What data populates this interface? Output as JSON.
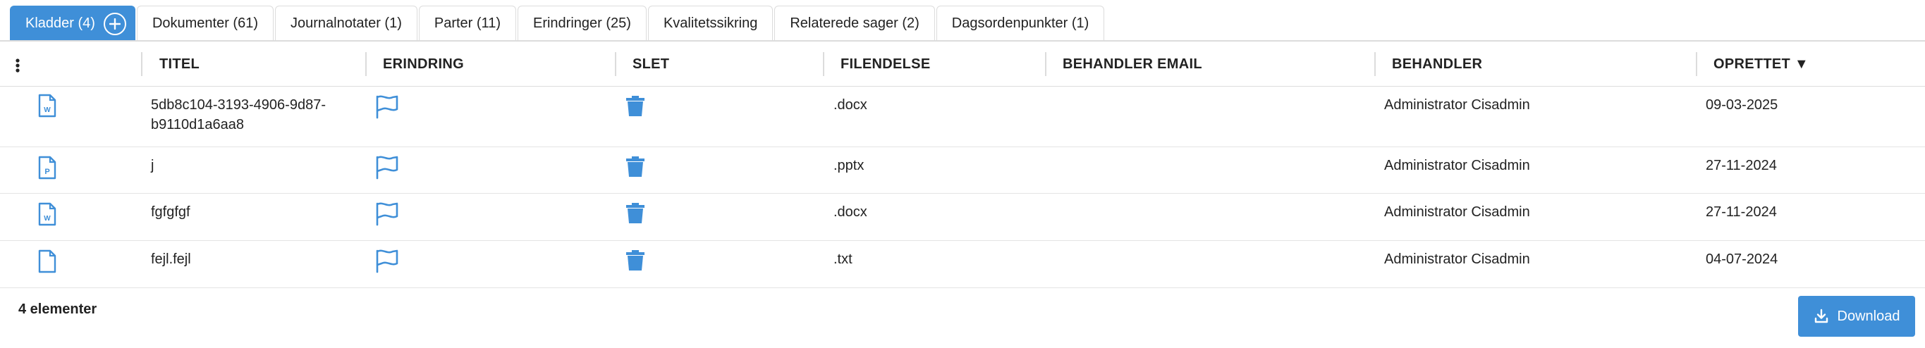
{
  "tabs": [
    {
      "label": "Kladder (4)",
      "active": true
    },
    {
      "label": "Dokumenter (61)"
    },
    {
      "label": "Journalnotater (1)"
    },
    {
      "label": "Parter (11)"
    },
    {
      "label": "Erindringer (25)"
    },
    {
      "label": "Kvalitetssikring"
    },
    {
      "label": "Relaterede sager (2)"
    },
    {
      "label": "Dagsordenpunkter (1)"
    }
  ],
  "table": {
    "columns": {
      "titel": "TITEL",
      "erindring": "ERINDRING",
      "slet": "SLET",
      "filendelse": "FILENDELSE",
      "behandler_email": "BEHANDLER EMAIL",
      "behandler": "BEHANDLER",
      "oprettet": "OPRETTET ▼"
    },
    "rows": [
      {
        "icon": "word-file-icon",
        "title_line1": "5db8c104-3193-4906-9d87-",
        "title_line2": "b9110d1a6aa8",
        "ext": ".docx",
        "email": "",
        "behandler": "Administrator Cisadmin",
        "oprettet": "09-03-2025"
      },
      {
        "icon": "powerpoint-file-icon",
        "title_line1": "j",
        "title_line2": "",
        "ext": ".pptx",
        "email": "",
        "behandler": "Administrator Cisadmin",
        "oprettet": "27-11-2024"
      },
      {
        "icon": "word-file-icon",
        "title_line1": "fgfgfgf",
        "title_line2": "",
        "ext": ".docx",
        "email": "",
        "behandler": "Administrator Cisadmin",
        "oprettet": "27-11-2024"
      },
      {
        "icon": "file-icon",
        "title_line1": "fejl.fejl",
        "title_line2": "",
        "ext": ".txt",
        "email": "",
        "behandler": "Administrator Cisadmin",
        "oprettet": "04-07-2024"
      }
    ]
  },
  "footer": {
    "count": "4 elementer",
    "download_label": "Download"
  },
  "colors": {
    "accent": "#3f8fd8",
    "border": "#dcdcdc"
  }
}
